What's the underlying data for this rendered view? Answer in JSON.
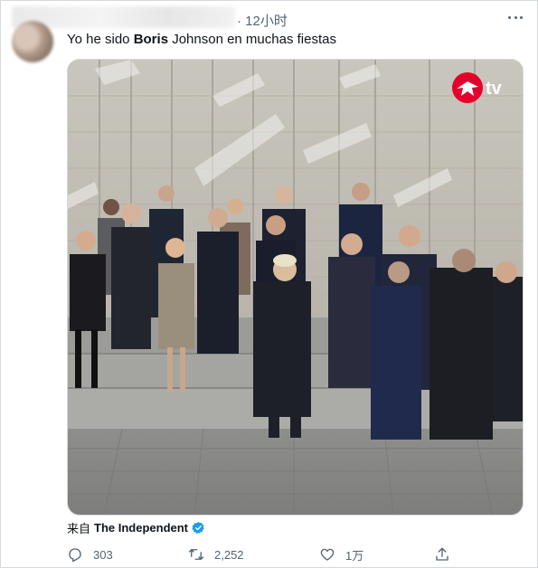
{
  "tweet": {
    "timestamp": "· 12小时",
    "text_before": "Yo he sido ",
    "text_bold": "Boris",
    "text_after": " Johnson en muchas fiestas",
    "source_prefix": "来自",
    "source_account": "The Independent",
    "media_logo_text": "tv",
    "icons": {
      "more": "more-horizontal-icon",
      "reply": "reply-icon",
      "retweet": "retweet-icon",
      "like": "heart-icon",
      "share": "share-icon",
      "verified": "verified-badge-icon"
    },
    "actions": {
      "reply_count": "303",
      "retweet_count": "2,252",
      "like_count": "1万"
    }
  },
  "colors": {
    "text": "#0f1419",
    "muted": "#536471",
    "verified": "#1d9bf0",
    "logo_red": "#e4002b"
  }
}
